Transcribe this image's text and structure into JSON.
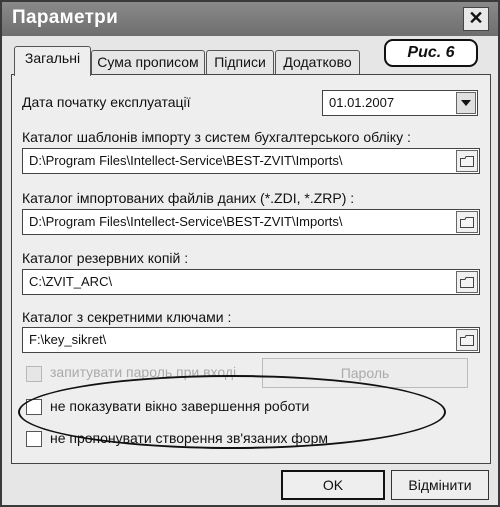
{
  "window": {
    "title": "Параметри",
    "close_symbol": "✕"
  },
  "figure_label": "Рис. 6",
  "tabs": [
    {
      "label": "Загальні",
      "active": true
    },
    {
      "label": "Сума прописом",
      "active": false
    },
    {
      "label": "Підписи",
      "active": false
    },
    {
      "label": "Додатково",
      "active": false
    }
  ],
  "start_date": {
    "label": "Дата початку експлуатації",
    "value": "01.01.2007"
  },
  "import_templates": {
    "label": "Каталог шаблонів імпорту з систем бухгалтерського обліку :",
    "value": "D:\\Program Files\\Intellect-Service\\BEST-ZVIT\\Imports\\"
  },
  "imported_files": {
    "label": "Каталог імпортованих файлів даних (*.ZDI, *.ZRP) :",
    "value": "D:\\Program Files\\Intellect-Service\\BEST-ZVIT\\Imports\\"
  },
  "backup": {
    "label": "Каталог резервних копій :",
    "value": "C:\\ZVIT_ARC\\"
  },
  "secret_keys": {
    "label": "Каталог з секретними ключами :",
    "value": "F:\\key_sikret\\"
  },
  "ask_password": {
    "label": "запитувати пароль при вході",
    "checked": false,
    "enabled": false
  },
  "password_button": {
    "label": "Пароль",
    "enabled": false
  },
  "no_finish_window": {
    "label": "не показувати вікно завершення роботи",
    "checked": false
  },
  "no_linked_forms": {
    "label": "не пропонувати створення зв'язаних форм",
    "checked": false
  },
  "ok_button": {
    "label": "OK"
  },
  "cancel_button": {
    "label": "Відмінити"
  }
}
